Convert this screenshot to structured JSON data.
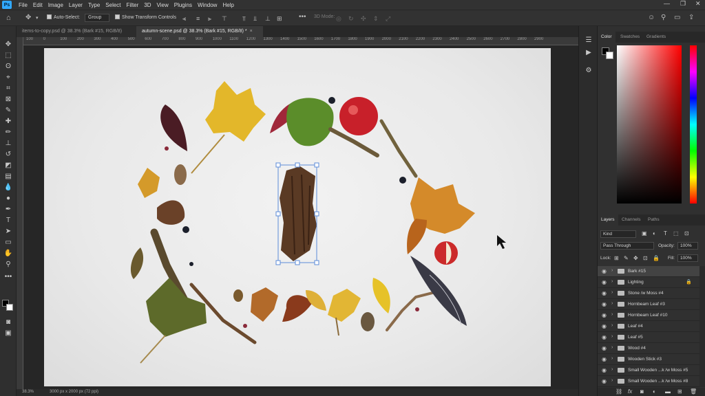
{
  "app": {
    "logo": "Ps"
  },
  "menu": [
    "File",
    "Edit",
    "Image",
    "Layer",
    "Type",
    "Select",
    "Filter",
    "3D",
    "View",
    "Plugins",
    "Window",
    "Help"
  ],
  "window_controls": [
    "—",
    "❐",
    "✕"
  ],
  "options": {
    "auto_select_label": "Auto-Select:",
    "auto_select_value": "Group",
    "transform_label": "Show Transform Controls",
    "mode_3d_label": "3D Mode:"
  },
  "tabs": [
    {
      "label": "items-to-copy.psd @ 38.3% (Bark #15, RGB/8)",
      "active": false
    },
    {
      "label": "autumn-scene.psd @ 38.3% (Bark #15, RGB/8) *",
      "active": true
    }
  ],
  "ruler_ticks": [
    "100",
    "0",
    "100",
    "200",
    "300",
    "400",
    "500",
    "600",
    "700",
    "800",
    "900",
    "1000",
    "1100",
    "1200",
    "1300",
    "1400",
    "1500",
    "1600",
    "1700",
    "1800",
    "1900",
    "2000",
    "2100",
    "2200",
    "2300",
    "2400",
    "2500",
    "2600",
    "2700",
    "2800",
    "2900"
  ],
  "status": {
    "zoom": "38.3%",
    "doc_size": "3000 px x 2000 px (72 ppi)"
  },
  "color_panel": {
    "tabs": [
      "Color",
      "Swatches",
      "Gradients"
    ],
    "foreground": "#000000",
    "background": "#ffffff",
    "hue": "#ff0000"
  },
  "layers_panel": {
    "tabs": [
      "Layers",
      "Channels",
      "Paths"
    ],
    "filter_kind": "Kind",
    "blend_mode": "Pass Through",
    "opacity_label": "Opacity:",
    "opacity_value": "100%",
    "lock_label": "Lock:",
    "fill_label": "Fill:",
    "fill_value": "100%",
    "layers": [
      {
        "name": "Bark #15",
        "selected": true,
        "locked": false
      },
      {
        "name": "Lighting",
        "selected": false,
        "locked": true
      },
      {
        "name": "Stone /w Moss #4",
        "selected": false,
        "locked": false
      },
      {
        "name": "Hornbeam Leaf #3",
        "selected": false,
        "locked": false
      },
      {
        "name": "Hornbeam Leaf #10",
        "selected": false,
        "locked": false
      },
      {
        "name": "Leaf #4",
        "selected": false,
        "locked": false
      },
      {
        "name": "Leaf #5",
        "selected": false,
        "locked": false
      },
      {
        "name": "Wood #4",
        "selected": false,
        "locked": false
      },
      {
        "name": "Wooden Stick #3",
        "selected": false,
        "locked": false
      },
      {
        "name": "Small Wooden ...k /w Moss #5",
        "selected": false,
        "locked": false
      },
      {
        "name": "Small Wooden ...k /w Moss #8",
        "selected": false,
        "locked": false
      }
    ],
    "footer_icons": [
      "link-icon",
      "fx-icon",
      "mask-icon",
      "adjustment-icon",
      "group-icon",
      "new-layer-icon",
      "trash-icon"
    ]
  },
  "colors": {
    "accent": "#31a8ff",
    "selection": "#5b8bd8"
  }
}
